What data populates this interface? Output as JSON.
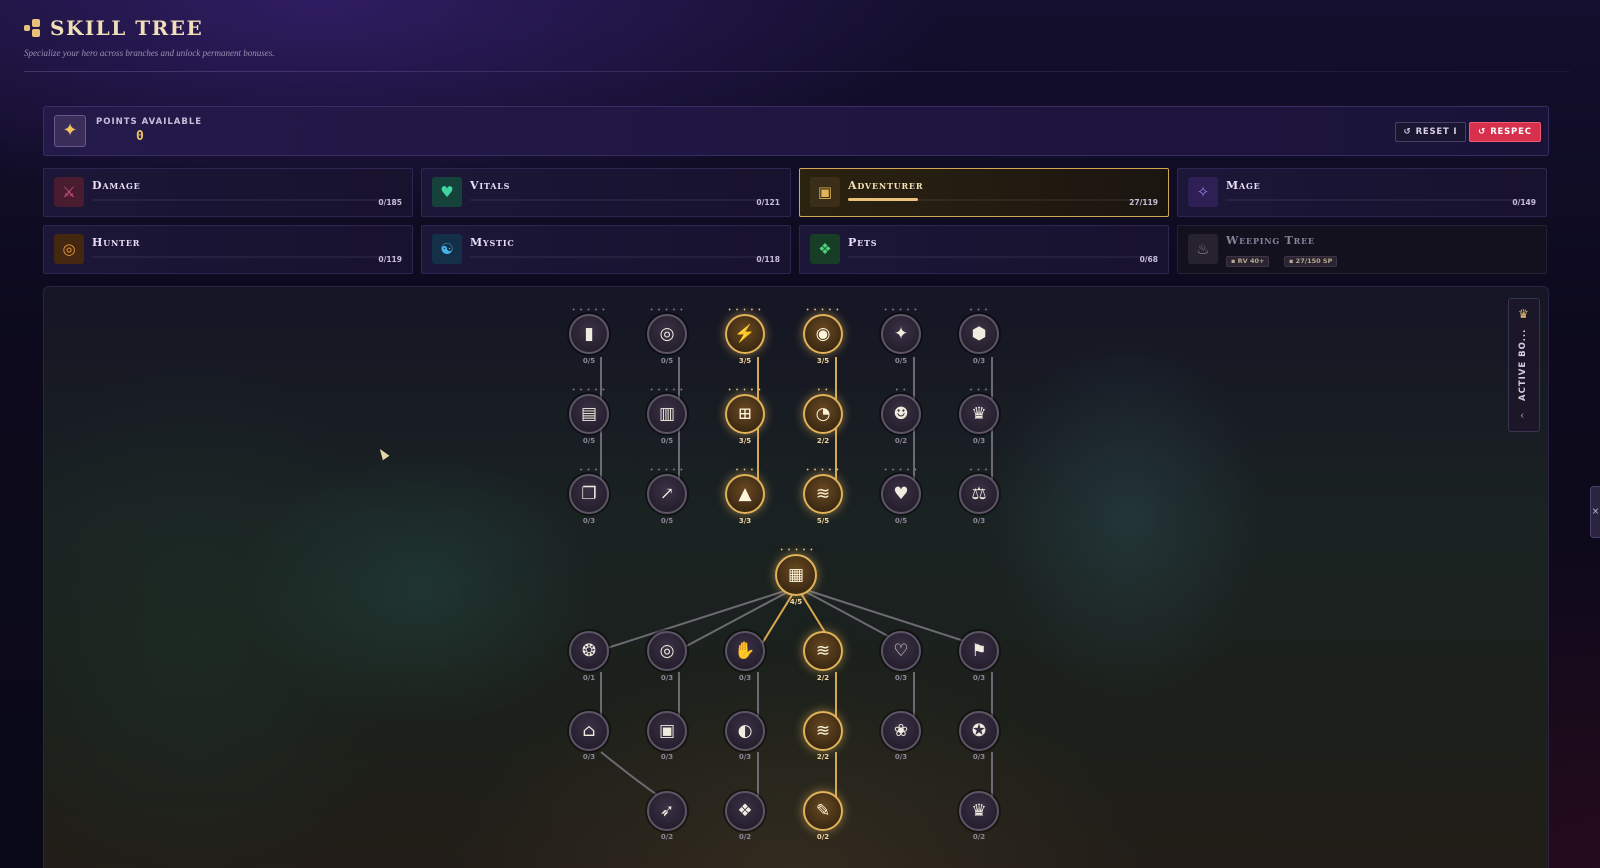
{
  "header": {
    "title": "SKILL TREE",
    "subtitle": "Specialize your hero across branches and unlock permanent bonuses."
  },
  "points": {
    "label": "POINTS AVAILABLE",
    "value": "0",
    "reset_label": "RESET I",
    "respec_label": "RESPEC"
  },
  "branches": [
    {
      "name": "Damage",
      "count": "0/185",
      "icon": "sword-icon",
      "accent": "#d24a6a"
    },
    {
      "name": "Vitals",
      "count": "0/121",
      "icon": "heart-icon",
      "accent": "#2fb88a"
    },
    {
      "name": "Adventurer",
      "count": "27/119",
      "icon": "backpack-icon",
      "accent": "#c9a25a",
      "progress": 0.227
    },
    {
      "name": "Mage",
      "count": "0/149",
      "icon": "wand-icon",
      "accent": "#7c5ad6"
    },
    {
      "name": "Hunter",
      "count": "0/119",
      "icon": "target-icon",
      "accent": "#e08a2a"
    },
    {
      "name": "Mystic",
      "count": "0/118",
      "icon": "yin-yang-icon",
      "accent": "#2f9fd6"
    },
    {
      "name": "Pets",
      "count": "0/68",
      "icon": "paw-icon",
      "accent": "#3fb86a"
    },
    {
      "name": "Weeping Tree",
      "icon": "flame-icon",
      "chips": [
        "RV 40+",
        "27/150 SP"
      ],
      "locked": true
    }
  ],
  "tree": {
    "row1": [
      {
        "icon": "book-icon",
        "glyph": "▮",
        "count": "0/5",
        "lit": false
      },
      {
        "icon": "coins-icon",
        "glyph": "◎",
        "count": "0/5",
        "lit": false
      },
      {
        "icon": "lightning-icon",
        "glyph": "⚡",
        "count": "3/5",
        "lit": true
      },
      {
        "icon": "eye-icon",
        "glyph": "◉",
        "count": "3/5",
        "lit": true
      },
      {
        "icon": "sparkle-icon",
        "glyph": "✦",
        "count": "0/5",
        "lit": false
      },
      {
        "icon": "box-icon",
        "glyph": "⬢",
        "count": "0/3",
        "lit": false
      }
    ],
    "row2": [
      {
        "icon": "scroll-icon",
        "glyph": "▤",
        "count": "0/5",
        "lit": false
      },
      {
        "icon": "buildings-icon",
        "glyph": "▥",
        "count": "0/5",
        "lit": false
      },
      {
        "icon": "dumbbell-icon",
        "glyph": "⊞",
        "count": "3/5",
        "lit": true
      },
      {
        "icon": "speedometer-icon",
        "glyph": "◔",
        "count": "2/2",
        "lit": true
      },
      {
        "icon": "group-icon",
        "glyph": "☻",
        "count": "0/2",
        "lit": false
      },
      {
        "icon": "crown-icon",
        "glyph": "♛",
        "count": "0/3",
        "lit": false
      }
    ],
    "row3": [
      {
        "icon": "open-book-icon",
        "glyph": "❐",
        "count": "0/3",
        "lit": false
      },
      {
        "icon": "trend-up-icon",
        "glyph": "↗",
        "count": "0/5",
        "lit": false
      },
      {
        "icon": "tree-icon",
        "glyph": "▲",
        "count": "3/3",
        "lit": true
      },
      {
        "icon": "wind-icon",
        "glyph": "≋",
        "count": "5/5",
        "lit": true
      },
      {
        "icon": "heart-icon",
        "glyph": "♥",
        "count": "0/5",
        "lit": false
      },
      {
        "icon": "scales-icon",
        "glyph": "⚖",
        "count": "0/3",
        "lit": false
      }
    ],
    "hub": {
      "icon": "map-icon",
      "glyph": "▦",
      "count": "4/5",
      "lit": true
    },
    "row4": [
      {
        "icon": "brain-icon",
        "glyph": "❂",
        "count": "0/1",
        "lit": false
      },
      {
        "icon": "coins-icon",
        "glyph": "◎",
        "count": "0/3",
        "lit": false
      },
      {
        "icon": "handshake-icon",
        "glyph": "✋",
        "count": "0/3",
        "lit": false
      },
      {
        "icon": "wind-icon",
        "glyph": "≋",
        "count": "2/2",
        "lit": true
      },
      {
        "icon": "shield-heart-icon",
        "glyph": "♡",
        "count": "0/3",
        "lit": false
      },
      {
        "icon": "flag-icon",
        "glyph": "⚑",
        "count": "0/3",
        "lit": false
      }
    ],
    "row5": [
      {
        "icon": "graduation-cap-icon",
        "glyph": "⌂",
        "count": "0/3",
        "lit": false
      },
      {
        "icon": "chest-icon",
        "glyph": "▣",
        "count": "0/3",
        "lit": false
      },
      {
        "icon": "egg-icon",
        "glyph": "◐",
        "count": "0/3",
        "lit": false
      },
      {
        "icon": "wind-icon",
        "glyph": "≋",
        "count": "2/2",
        "lit": true
      },
      {
        "icon": "lotus-icon",
        "glyph": "❀",
        "count": "0/3",
        "lit": false
      },
      {
        "icon": "medal-icon",
        "glyph": "✪",
        "count": "0/3",
        "lit": false
      }
    ],
    "row6": [
      {
        "icon": "feather-icon",
        "glyph": "➶",
        "count": "0/2",
        "lit": false
      },
      {
        "icon": "paw-icon",
        "glyph": "❖",
        "count": "0/2",
        "lit": false
      },
      {
        "icon": "wrench-icon",
        "glyph": "✎",
        "count": "0/2",
        "lit": true
      },
      {
        "icon": "crown-icon",
        "glyph": "♛",
        "count": "0/2",
        "lit": false
      }
    ]
  },
  "active_boosts": {
    "label": "ACTIVE BO...",
    "icon": "trophy-icon"
  },
  "colors": {
    "accent_gold": "#e8c27a",
    "respec_red": "#d6304d",
    "panel_bg": "#1c1638"
  }
}
